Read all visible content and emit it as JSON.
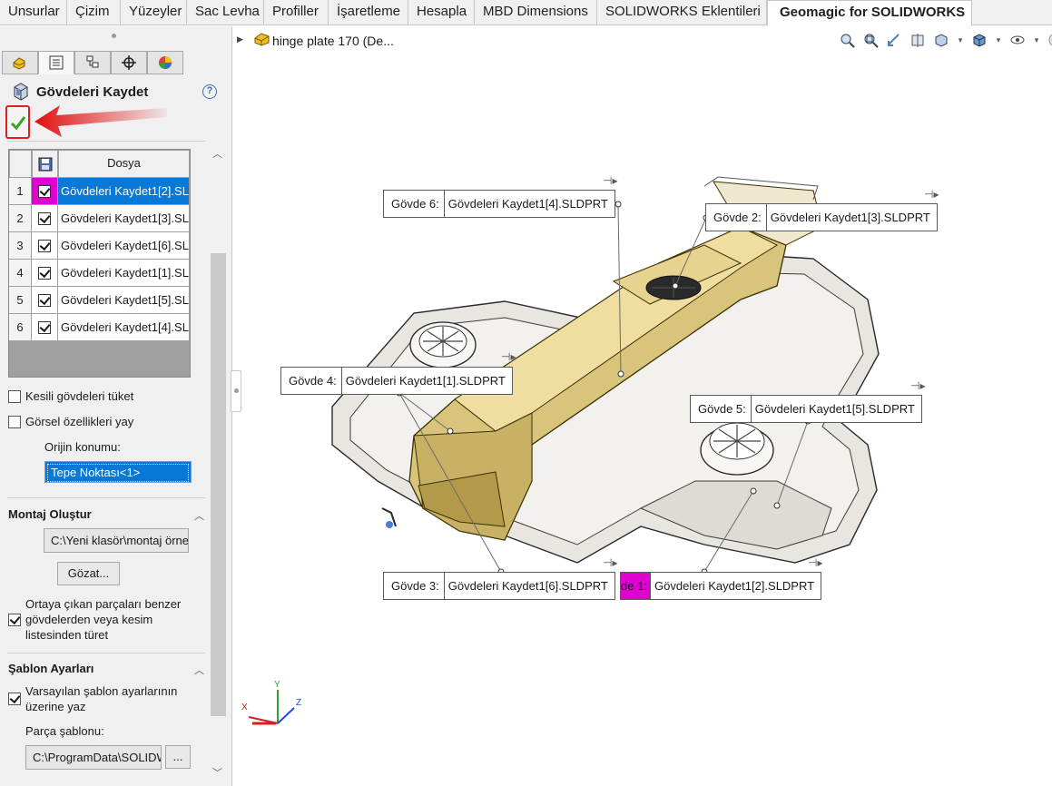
{
  "tabs": [
    "Unsurlar",
    "Çizim",
    "Yüzeyler",
    "Sac Levha",
    "Profiller",
    "İşaretleme",
    "Hesapla",
    "MBD Dimensions",
    "SOLIDWORKS Eklentileri",
    "Geomagic for SOLIDWORKS"
  ],
  "property_manager": {
    "title": "Gövdeleri Kaydet",
    "help": "?",
    "table": {
      "header": "Dosya",
      "rows": [
        {
          "num": "1",
          "name": "Gövdeleri Kaydet1[2].SL"
        },
        {
          "num": "2",
          "name": "Gövdeleri Kaydet1[3].SL"
        },
        {
          "num": "3",
          "name": "Gövdeleri Kaydet1[6].SL"
        },
        {
          "num": "4",
          "name": "Gövdeleri Kaydet1[1].SL"
        },
        {
          "num": "5",
          "name": "Gövdeleri Kaydet1[5].SL"
        },
        {
          "num": "6",
          "name": "Gövdeleri Kaydet1[4].SL"
        }
      ]
    },
    "options": {
      "consume_cut": "Kesili gövdeleri tüket",
      "visual_props": "Görsel özellikleri yay",
      "origin_label": "Orijin konumu:",
      "origin_value": "Tepe Noktası<1>"
    },
    "assembly": {
      "title": "Montaj Oluştur",
      "path": "C:\\Yeni klasör\\montaj örne",
      "browse": "Gözat...",
      "derive": "Ortaya çıkan parçaları benzer gövdelerden veya kesim listesinden türet"
    },
    "template": {
      "title": "Şablon Ayarları",
      "override": "Varsayılan şablon ayarlarının üzerine yaz",
      "part_template_label": "Parça şablonu:",
      "part_template_path": "C:\\ProgramData\\SOLIDW",
      "browse_small": "..."
    }
  },
  "graphics": {
    "part_name": "hinge plate 170  (De...",
    "callouts": [
      {
        "tag": "Gövde  6:",
        "name": "Gövdeleri Kaydet1[4].SLDPRT"
      },
      {
        "tag": "Gövde  2:",
        "name": "Gövdeleri Kaydet1[3].SLDPRT"
      },
      {
        "tag": "Gövde  4:",
        "name": "Gövdeleri Kaydet1[1].SLDPRT"
      },
      {
        "tag": "Gövde  5:",
        "name": "Gövdeleri Kaydet1[5].SLDPRT"
      },
      {
        "tag": "Gövde  3:",
        "name": "Gövdeleri Kaydet1[6].SLDPRT"
      },
      {
        "tag": "de  1:",
        "name": "Gövdeleri Kaydet1[2].SLDPRT"
      }
    ],
    "triad": {
      "x": "X",
      "y": "Y",
      "z": "Z"
    }
  },
  "colors": {
    "accent": "#0a78d7",
    "highlight": "#e000d0",
    "body_gold": "#d8c27a",
    "body_grey": "#e8e4df"
  }
}
